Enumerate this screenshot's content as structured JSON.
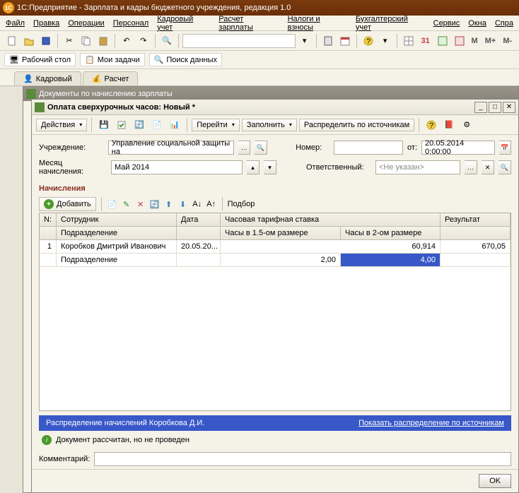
{
  "app": {
    "title": "1С:Предприятие - Зарплата и кадры бюджетного учреждения, редакция 1.0"
  },
  "menu": {
    "file": "Файл",
    "edit": "Правка",
    "ops": "Операции",
    "personnel": "Персонал",
    "hr": "Кадровый учет",
    "payroll": "Расчет зарплаты",
    "taxes": "Налоги и взносы",
    "accounting": "Бухгалтерский учет",
    "service": "Сервис",
    "windows": "Окна",
    "help": "Спра"
  },
  "nav": {
    "desktop": "Рабочий стол",
    "tasks": "Мои задачи",
    "search": "Поиск данных"
  },
  "tabs": {
    "hr": "Кадровый",
    "payroll": "Расчет"
  },
  "m": {
    "m": "M",
    "mplus": "M+",
    "mminus": "M-"
  },
  "doc_list": {
    "title": "Документы по начислению зарплаты"
  },
  "doc": {
    "title": "Оплата сверхурочных часов: Новый *",
    "actions": "Действия",
    "goto": "Перейти",
    "fill": "Заполнить",
    "distribute": "Распределить по источникам",
    "labels": {
      "org": "Учреждение:",
      "month": "Месяц начисления:",
      "number": "Номер:",
      "from": "от:",
      "responsible": "Ответственный:"
    },
    "values": {
      "org": "Управление социальной защиты на",
      "month": "Май 2014",
      "number": "",
      "date": "20.05.2014 0:00:00",
      "responsible": "<Не указан>"
    },
    "section": "Начисления",
    "add": "Добавить",
    "select": "Подбор",
    "grid": {
      "headers": {
        "num": "N:",
        "employee": "Сотрудник",
        "date": "Дата",
        "rate": "Часовая тарифная ставка",
        "result": "Результат",
        "dept": "Подразделение",
        "h15": "Часы в 1.5-ом размере",
        "h2": "Часы в 2-ом размере"
      },
      "rows": [
        {
          "num": "1",
          "employee": "Коробков Дмитрий Иванович",
          "date": "20.05.20...",
          "rate": "60,914",
          "result": "670,05",
          "dept": "Подразделение",
          "h15": "2,00",
          "h2": "4,00"
        }
      ]
    },
    "status": {
      "dist": "Распределение начислений Коробкова Д.И.",
      "link": "Показать распределение по источникам"
    },
    "calc": "Документ рассчитан, но не проведен",
    "comment_label": "Комментарий:",
    "ok": "OK"
  }
}
